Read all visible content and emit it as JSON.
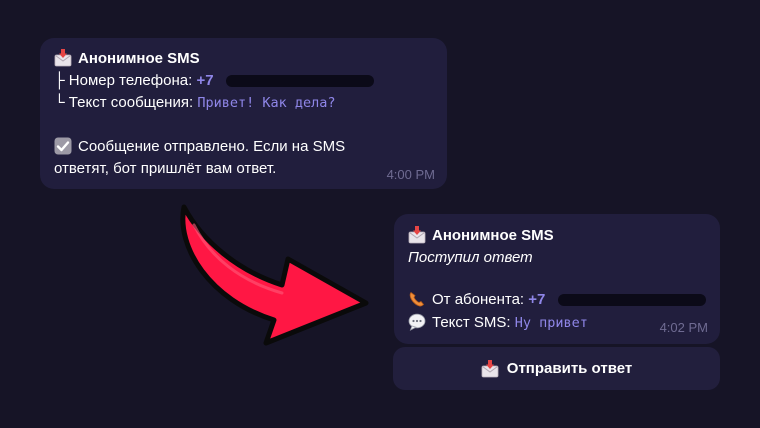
{
  "message1": {
    "title": "Анонимное SMS",
    "phone_label": "├ Номер телефона:",
    "phone_prefix": "+7",
    "text_label": "└ Текст сообщения:",
    "text_value": "Привет! Как дела?",
    "status_line1": "Сообщение отправлено. Если на SMS",
    "status_line2": "ответят, бот пришлёт вам ответ.",
    "time": "4:00 PM"
  },
  "message2": {
    "title": "Анонимное SMS",
    "subtitle": "Поступил ответ",
    "from_label": "От абонента:",
    "from_prefix": "+7",
    "text_label": "Текст SMS:",
    "text_value": "Ну привет",
    "time": "4:02 PM"
  },
  "reply_button": {
    "label": "Отправить ответ"
  },
  "colors": {
    "background": "#161426",
    "bubble": "#211e3d",
    "accent_text": "#8f86e8",
    "timestamp": "#6f6b92",
    "arrow_red": "#ff1744"
  },
  "icons": {
    "title_icon": "envelope-with-down-arrow-icon",
    "status_icon": "check-box-icon",
    "from_icon": "telephone-receiver-icon",
    "text_icon": "speech-bubble-icon"
  }
}
